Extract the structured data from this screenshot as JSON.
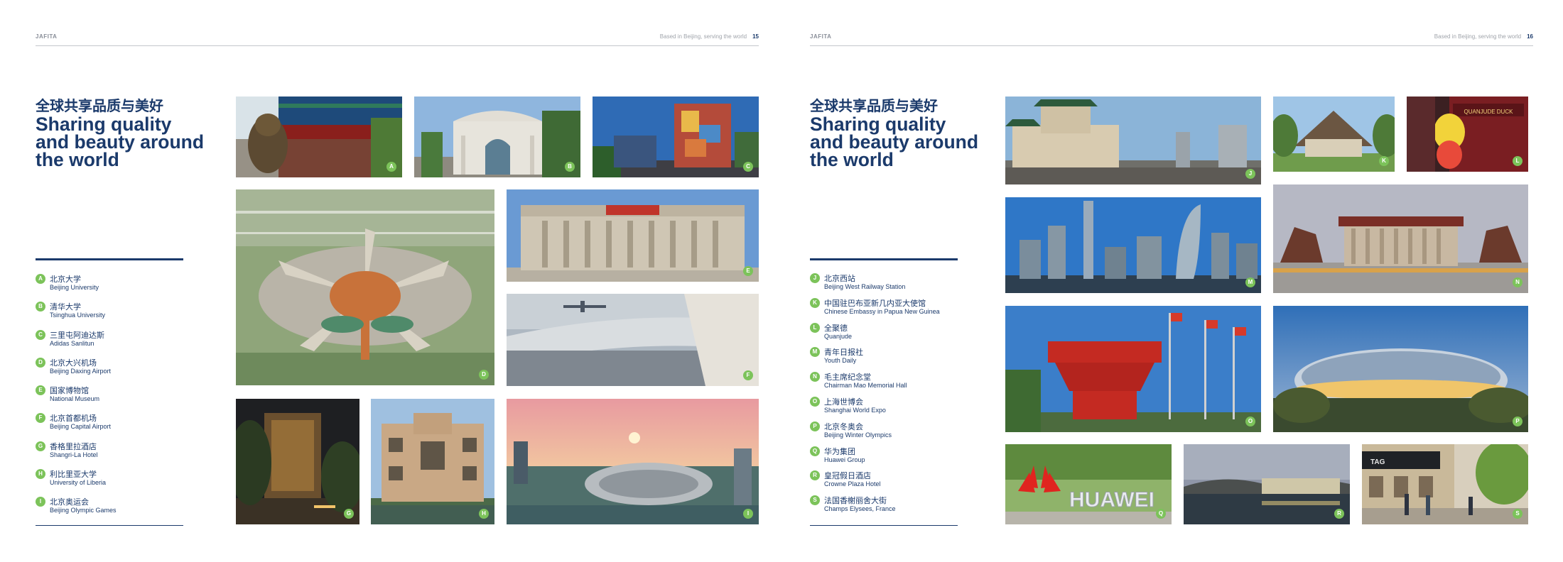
{
  "pages": [
    {
      "brand": "JAFITA",
      "tagline": "Based in Beijing, serving the world",
      "page_number": "15",
      "title_cn": "全球共享品质与美好",
      "title_en": "Sharing quality and beauty around the world",
      "legend": [
        {
          "letter": "A",
          "cn": "北京大学",
          "en": "Beijing University"
        },
        {
          "letter": "B",
          "cn": "清华大学",
          "en": "Tsinghua University"
        },
        {
          "letter": "C",
          "cn": "三里屯阿迪达斯",
          "en": "Adidas Sanlitun"
        },
        {
          "letter": "D",
          "cn": "北京大兴机场",
          "en": "Beijing Daxing Airport"
        },
        {
          "letter": "E",
          "cn": "国家博物馆",
          "en": "National Museum"
        },
        {
          "letter": "F",
          "cn": "北京首都机场",
          "en": "Beijing Capital Airport"
        },
        {
          "letter": "G",
          "cn": "香格里拉酒店",
          "en": "Shangri-La Hotel"
        },
        {
          "letter": "H",
          "cn": "利比里亚大学",
          "en": "University of Liberia"
        },
        {
          "letter": "I",
          "cn": "北京奥运会",
          "en": "Beijing Olympic Games"
        }
      ],
      "photo_badges": [
        "A",
        "B",
        "C",
        "D",
        "E",
        "F",
        "G",
        "H",
        "I"
      ]
    },
    {
      "brand": "JAFITA",
      "tagline": "Based in Beijing, serving the world",
      "page_number": "16",
      "title_cn": "全球共享品质与美好",
      "title_en": "Sharing quality and beauty around the world",
      "legend": [
        {
          "letter": "J",
          "cn": "北京西站",
          "en": "Beijing West Railway Station"
        },
        {
          "letter": "K",
          "cn": "中国驻巴布亚新几内亚大使馆",
          "en": "Chinese Embassy in Papua New Guinea"
        },
        {
          "letter": "L",
          "cn": "全聚德",
          "en": "Quanjude"
        },
        {
          "letter": "M",
          "cn": "青年日报社",
          "en": "Youth Daily"
        },
        {
          "letter": "N",
          "cn": "毛主席纪念堂",
          "en": "Chairman Mao Memorial Hall"
        },
        {
          "letter": "O",
          "cn": "上海世博会",
          "en": "Shanghai World Expo"
        },
        {
          "letter": "P",
          "cn": "北京冬奥会",
          "en": "Beijing Winter Olympics"
        },
        {
          "letter": "Q",
          "cn": "华为集团",
          "en": "Huawei Group"
        },
        {
          "letter": "R",
          "cn": "皇冠假日酒店",
          "en": "Crowne Plaza Hotel"
        },
        {
          "letter": "S",
          "cn": "法国香榭丽舍大街",
          "en": "Champs Elysees, France"
        }
      ],
      "photo_badges": [
        "J",
        "K",
        "L",
        "M",
        "N",
        "O",
        "P",
        "Q",
        "R",
        "S"
      ],
      "signage": {
        "huawei": "HUAWEI",
        "quanjude": "QUANJUDE DUCK",
        "shop": "TAG"
      }
    }
  ],
  "colors": {
    "navy": "#1b3a6b",
    "badge_green": "#7cc35a",
    "rule_gray": "#c4c7cc"
  }
}
